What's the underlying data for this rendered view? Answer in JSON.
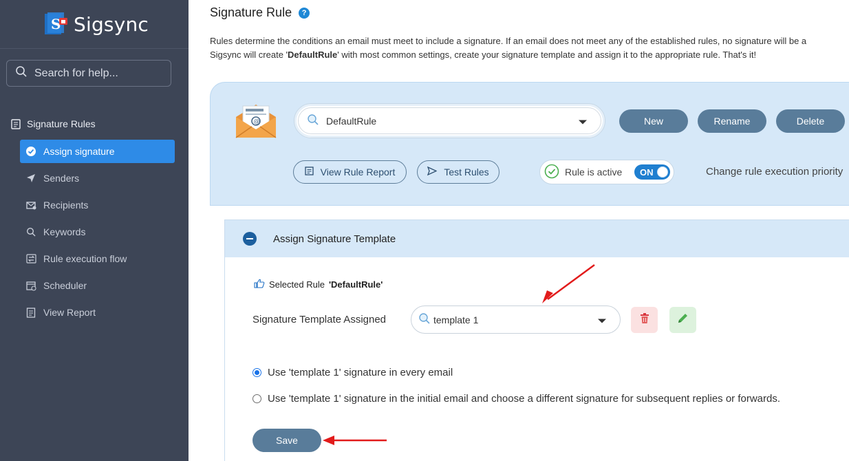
{
  "sidebar": {
    "logo_text": "Sigsync",
    "search_placeholder": "Search for help...",
    "section_label": "Signature Rules",
    "items": [
      {
        "label": "Assign signature",
        "icon": "check-circle-icon",
        "active": true
      },
      {
        "label": "Senders",
        "icon": "send-icon"
      },
      {
        "label": "Recipients",
        "icon": "recipients-icon"
      },
      {
        "label": "Keywords",
        "icon": "search-icon"
      },
      {
        "label": "Rule execution flow",
        "icon": "flow-icon"
      },
      {
        "label": "Scheduler",
        "icon": "calendar-icon"
      },
      {
        "label": "View Report",
        "icon": "report-icon"
      }
    ]
  },
  "header": {
    "title": "Signature Rule",
    "desc_line1": "Rules determine the conditions an email must meet to include a signature. If an email does not meet any of the established rules, no signature will be a",
    "desc_line2_pre": "Sigsync will create '",
    "desc_line2_bold": "DefaultRule",
    "desc_line2_post": "' with most common settings, create your signature template and assign it to the appropriate rule. That's it!"
  },
  "rule_panel": {
    "selected_rule": "DefaultRule",
    "new_label": "New",
    "rename_label": "Rename",
    "delete_label": "Delete",
    "view_report_label": "View Rule Report",
    "test_rules_label": "Test Rules",
    "active_label": "Rule is active",
    "toggle_label": "ON",
    "priority_label": "Change rule execution priority"
  },
  "template_card": {
    "header_title": "Assign Signature Template",
    "selected_rule_prefix": "Selected Rule ",
    "selected_rule_name": "'DefaultRule'",
    "assigned_label": "Signature Template Assigned",
    "template_value": "template 1",
    "option1": "Use 'template 1' signature in every email",
    "option2": "Use 'template 1' signature in the initial email and choose a different signature for subsequent replies or forwards.",
    "save_label": "Save"
  },
  "colors": {
    "sidebar_bg": "#3d4556",
    "active_item": "#2e8be7",
    "panel_bg": "#d6e8f8",
    "button": "#597c9a",
    "toggle_on": "#1f7fd0",
    "annotation_arrow": "#e21b1b"
  }
}
